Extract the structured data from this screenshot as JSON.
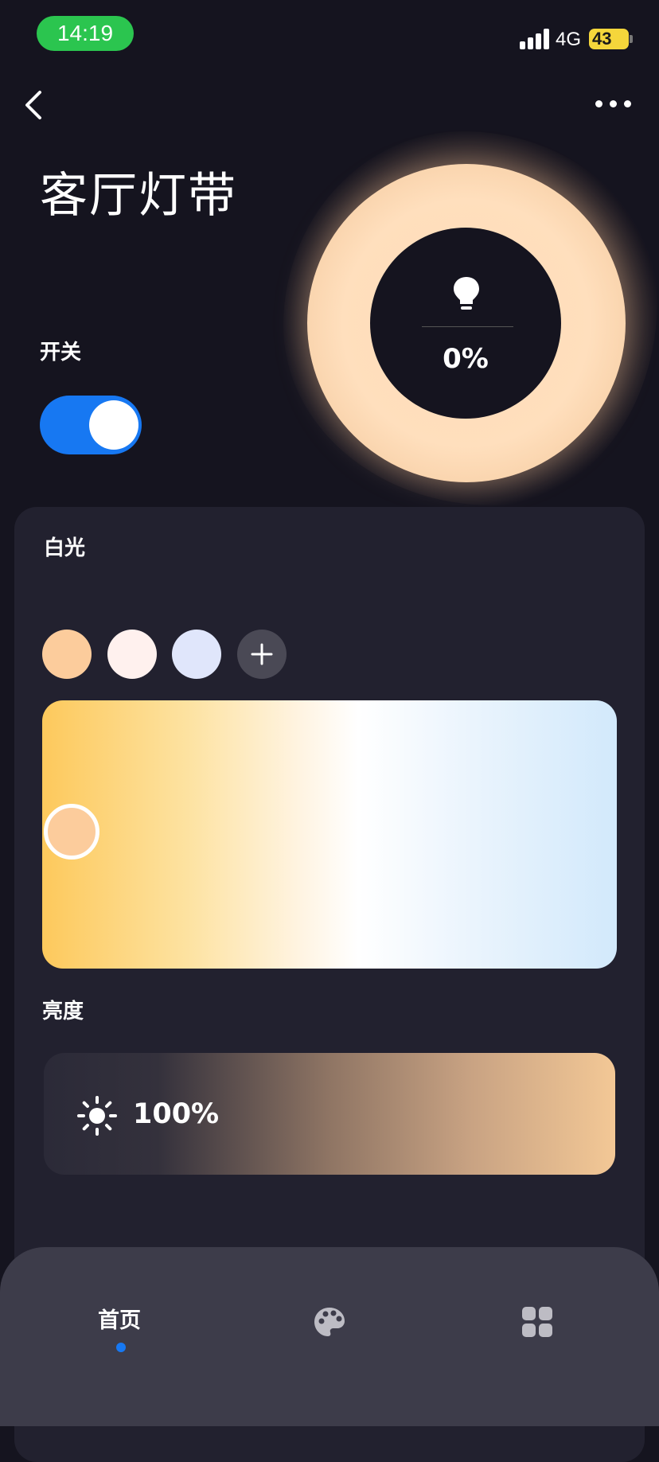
{
  "status_bar": {
    "time": "14:19",
    "network": "4G",
    "battery": "43"
  },
  "header": {
    "title": "客厅灯带"
  },
  "power": {
    "label": "开关",
    "on": true
  },
  "lamp": {
    "brightness_display": "0%",
    "icon": "bulb-icon"
  },
  "white_light": {
    "label": "白光",
    "presets": [
      "#fccc9c",
      "#fff1ee",
      "#e0e6fb"
    ],
    "add_icon": "plus-icon",
    "gradient_colors": [
      "#fdc95c",
      "#ffffff",
      "#d2e9fb"
    ],
    "knob_color": "#fccc9c"
  },
  "brightness": {
    "label": "亮度",
    "value": "100%",
    "icon": "sun-icon"
  },
  "tabbar": {
    "home_label": "首页",
    "active_color": "#1778f2",
    "tabs": [
      "home",
      "palette-icon",
      "grid-icon"
    ]
  }
}
